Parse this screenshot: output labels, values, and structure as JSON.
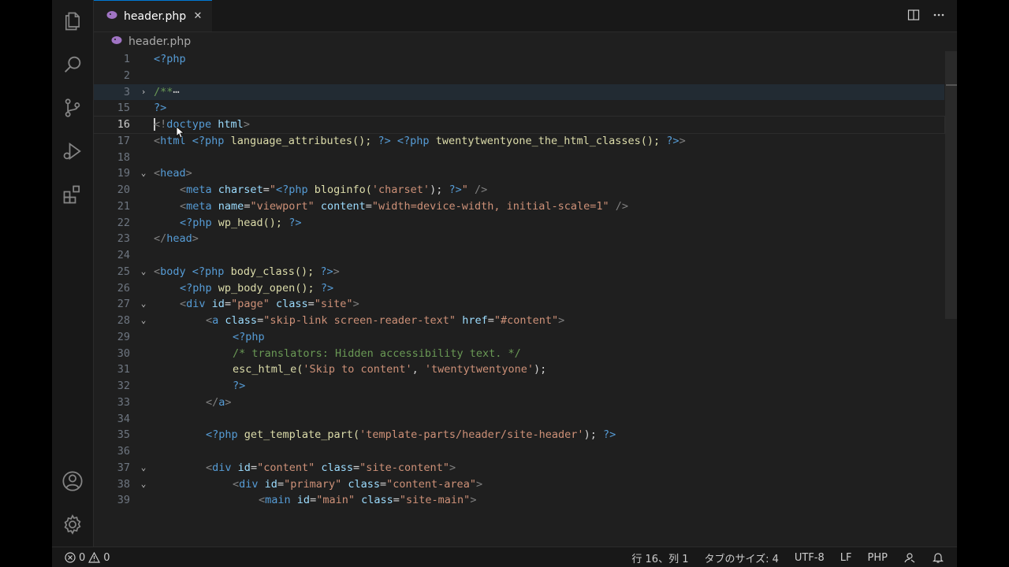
{
  "tab": {
    "label": "header.php",
    "close": "✕"
  },
  "breadcrumb": {
    "file": "header.php"
  },
  "editor": {
    "lines": [
      {
        "n": "1"
      },
      {
        "n": "2"
      },
      {
        "n": "3"
      },
      {
        "n": "15"
      },
      {
        "n": "16"
      },
      {
        "n": "17"
      },
      {
        "n": "18"
      },
      {
        "n": "19"
      },
      {
        "n": "20"
      },
      {
        "n": "21"
      },
      {
        "n": "22"
      },
      {
        "n": "23"
      },
      {
        "n": "24"
      },
      {
        "n": "25"
      },
      {
        "n": "26"
      },
      {
        "n": "27"
      },
      {
        "n": "28"
      },
      {
        "n": "29"
      },
      {
        "n": "30"
      },
      {
        "n": "31"
      },
      {
        "n": "32"
      },
      {
        "n": "33"
      },
      {
        "n": "34"
      },
      {
        "n": "35"
      },
      {
        "n": "36"
      },
      {
        "n": "37"
      },
      {
        "n": "38"
      },
      {
        "n": "39"
      }
    ],
    "code": {
      "l1": "<?php",
      "l3a": "/**",
      "l3b": "⋯",
      "l15": "?>",
      "l16a": "<!",
      "l16b": "doctype",
      "l16c": " html",
      "l16d": ">",
      "l17": [
        "<",
        "html",
        " ",
        "<?php",
        " language_attributes(); ",
        "?>",
        " ",
        "<?php",
        " twentytwentyone_the_html_classes(); ",
        "?>",
        ">"
      ],
      "l19": [
        "<",
        "head",
        ">"
      ],
      "l20": [
        "<",
        "meta",
        " ",
        "charset",
        "=",
        "\"",
        "<?php",
        " bloginfo(",
        "'charset'",
        "); ",
        "?>",
        "\"",
        " />"
      ],
      "l21": [
        "<",
        "meta",
        " ",
        "name",
        "=",
        "\"viewport\"",
        " ",
        "content",
        "=",
        "\"width=device-width, initial-scale=1\"",
        " />"
      ],
      "l22": [
        "<?php",
        " wp_head(); ",
        "?>"
      ],
      "l23": [
        "</",
        "head",
        ">"
      ],
      "l25": [
        "<",
        "body",
        " ",
        "<?php",
        " body_class(); ",
        "?>",
        ">"
      ],
      "l26": [
        "<?php",
        " wp_body_open(); ",
        "?>"
      ],
      "l27": [
        "<",
        "div",
        " ",
        "id",
        "=",
        "\"page\"",
        " ",
        "class",
        "=",
        "\"site\"",
        ">"
      ],
      "l28": [
        "<",
        "a",
        " ",
        "class",
        "=",
        "\"skip-link screen-reader-text\"",
        " ",
        "href",
        "=",
        "\"#content\"",
        ">"
      ],
      "l29": "<?php",
      "l30": "/* translators: Hidden accessibility text. */",
      "l31": [
        "esc_html_e(",
        "'Skip to content'",
        ", ",
        "'twentytwentyone'",
        ");"
      ],
      "l32": "?>",
      "l33": [
        "</",
        "a",
        ">"
      ],
      "l35": [
        "<?php",
        " get_template_part(",
        "'template-parts/header/site-header'",
        "); ",
        "?>"
      ],
      "l37": [
        "<",
        "div",
        " ",
        "id",
        "=",
        "\"content\"",
        " ",
        "class",
        "=",
        "\"site-content\"",
        ">"
      ],
      "l38": [
        "<",
        "div",
        " ",
        "id",
        "=",
        "\"primary\"",
        " ",
        "class",
        "=",
        "\"content-area\"",
        ">"
      ],
      "l39": [
        "<",
        "main",
        " ",
        "id",
        "=",
        "\"main\"",
        " ",
        "class",
        "=",
        "\"site-main\"",
        ">"
      ]
    }
  },
  "status": {
    "errors": "0",
    "warnings": "0",
    "position": "行 16、列 1",
    "tab_size": "タブのサイズ: 4",
    "encoding": "UTF-8",
    "eol": "LF",
    "language": "PHP"
  },
  "icons": {
    "explorer": "files-icon",
    "search": "search-icon",
    "scm": "source-control-icon",
    "debug": "run-debug-icon",
    "extensions": "extensions-icon",
    "account": "account-icon",
    "settings": "gear-icon"
  },
  "colors": {
    "accent": "#0078d4",
    "php_icon": "#a074c4"
  }
}
